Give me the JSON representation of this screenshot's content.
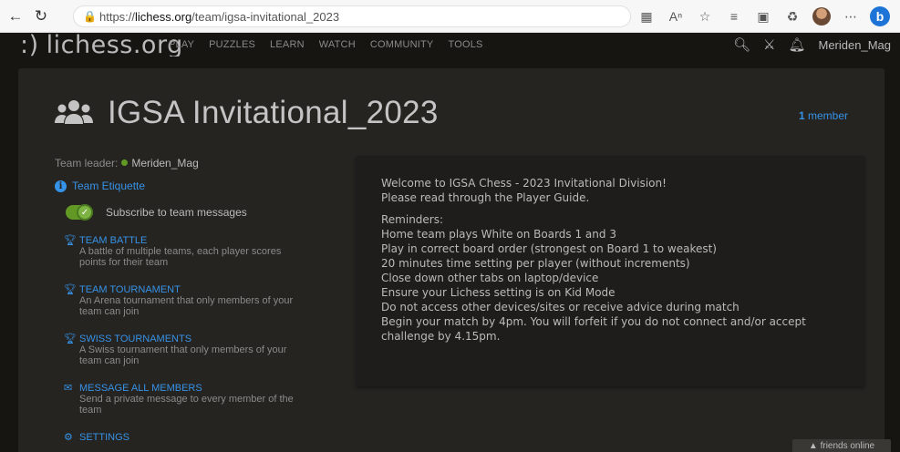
{
  "browser": {
    "url_prefix": "https://",
    "url_host": "lichess.org",
    "url_path": "/team/igsa-invitational_2023"
  },
  "header": {
    "logo_smile": ":)",
    "logo_text": "lichess.org",
    "nav": [
      "PLAY",
      "PUZZLES",
      "LEARN",
      "WATCH",
      "COMMUNITY",
      "TOOLS"
    ],
    "username": "Meriden_Mag"
  },
  "team": {
    "name": "IGSA Invitational_2023",
    "member_count": "1",
    "member_label": "member",
    "leader_label": "Team leader:",
    "leader_name": "Meriden_Mag",
    "etiquette_label": "Team Etiquette",
    "subscribe_label": "Subscribe to team messages",
    "subscribed": true
  },
  "actions": [
    {
      "title": "TEAM BATTLE",
      "desc": "A battle of multiple teams, each player scores points for their team",
      "icon": "trophy-icon"
    },
    {
      "title": "TEAM TOURNAMENT",
      "desc": "An Arena tournament that only members of your team can join",
      "icon": "trophy-icon"
    },
    {
      "title": "SWISS TOURNAMENTS",
      "desc": "A Swiss tournament that only members of your team can join",
      "icon": "trophy-icon"
    },
    {
      "title": "MESSAGE ALL MEMBERS",
      "desc": "Send a private message to every member of the team",
      "icon": "envelope-icon"
    },
    {
      "title": "SETTINGS",
      "desc": "",
      "icon": "gear-icon"
    }
  ],
  "description": {
    "intro1": "Welcome to IGSA Chess - 2023 Invitational Division!",
    "intro2": "Please read through the Player Guide.",
    "reminders_title": "Reminders:",
    "reminders": [
      "Home team plays White on Boards 1 and 3",
      "Play in correct board order (strongest on Board 1 to weakest)",
      "20 minutes time setting per player (without increments)",
      "Close down other tabs on laptop/device",
      "Ensure your Lichess setting is on Kid Mode",
      "Do not access other devices/sites or receive advice during match",
      "Begin your match by 4pm. You will forfeit if you do not connect and/or accept challenge by 4.15pm."
    ]
  },
  "footer": {
    "friends_label": "▲ friends online"
  }
}
